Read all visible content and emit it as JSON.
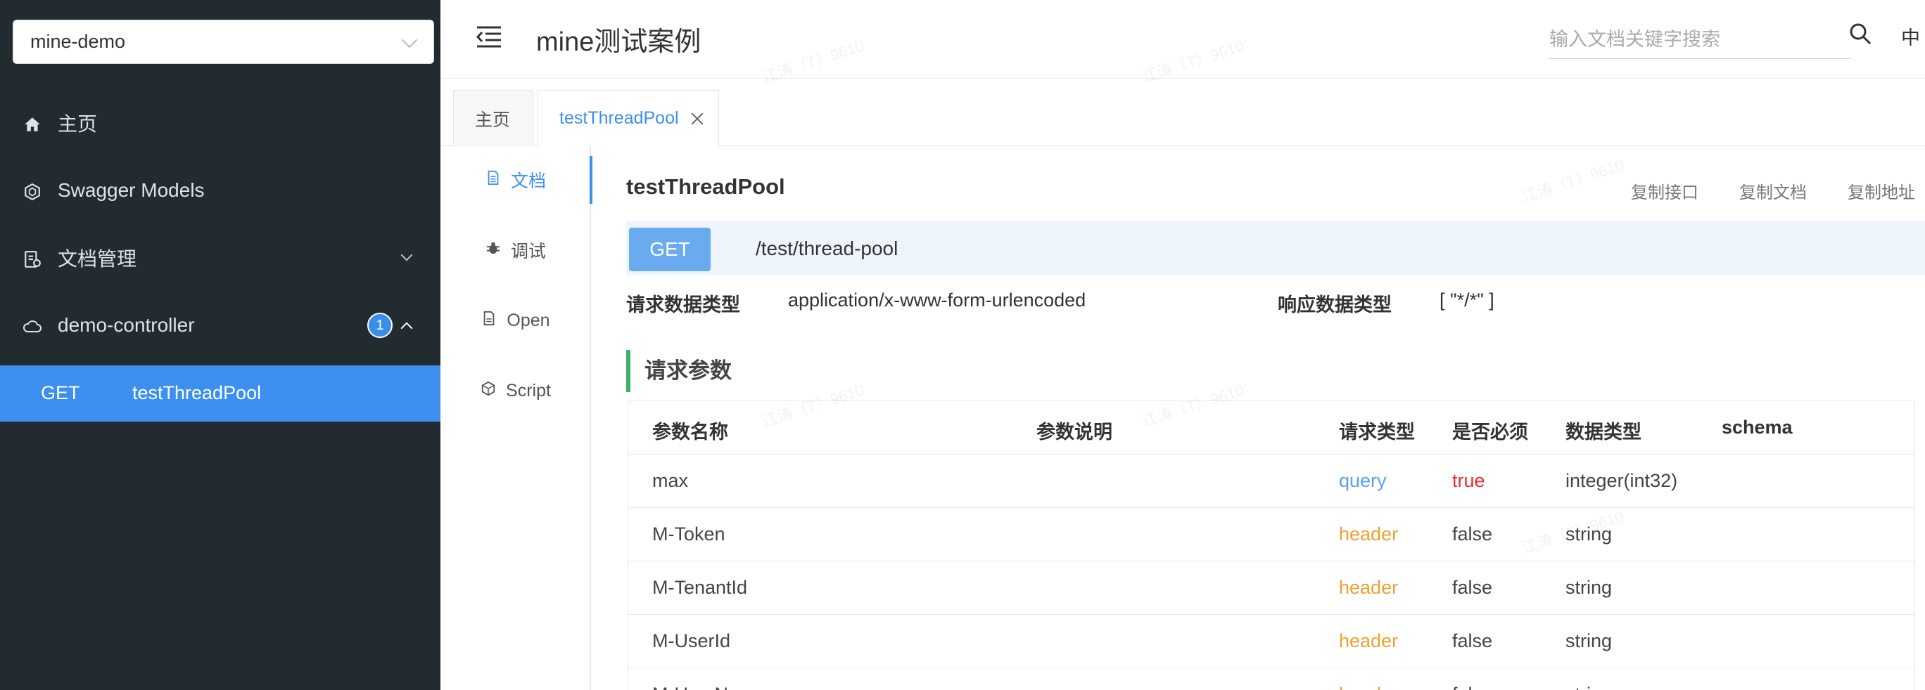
{
  "sidebar": {
    "project_select": "mine-demo",
    "items": [
      {
        "label": "主页",
        "icon": "home-icon"
      },
      {
        "label": "Swagger Models",
        "icon": "models-icon"
      },
      {
        "label": "文档管理",
        "icon": "doc-manage-icon"
      },
      {
        "label": "demo-controller",
        "icon": "cloud-icon",
        "badge": "1"
      }
    ],
    "active_api": {
      "method": "GET",
      "name": "testThreadPool"
    }
  },
  "header": {
    "title": "mine测试案例",
    "search_placeholder": "输入文档关键字搜索",
    "lang": "中"
  },
  "tabs": [
    {
      "label": "主页"
    },
    {
      "label": "testThreadPool"
    }
  ],
  "side_tabs": [
    {
      "label": "文档",
      "icon": "document-icon"
    },
    {
      "label": "调试",
      "icon": "bug-icon"
    },
    {
      "label": "Open",
      "icon": "file-icon"
    },
    {
      "label": "Script",
      "icon": "code-icon"
    }
  ],
  "api": {
    "name": "testThreadPool",
    "actions": [
      "复制接口",
      "复制文档",
      "复制地址"
    ],
    "method": "GET",
    "path": "/test/thread-pool",
    "request_type_label": "请求数据类型",
    "request_type": "application/x-www-form-urlencoded",
    "response_type_label": "响应数据类型",
    "response_type": "[ \"*/*\" ]"
  },
  "params": {
    "section_title": "请求参数",
    "columns": [
      "参数名称",
      "参数说明",
      "请求类型",
      "是否必须",
      "数据类型",
      "schema"
    ],
    "rows": [
      {
        "name": "max",
        "desc": "",
        "in": "query",
        "required": "true",
        "type": "integer(int32)",
        "schema": ""
      },
      {
        "name": "M-Token",
        "desc": "",
        "in": "header",
        "required": "false",
        "type": "string",
        "schema": ""
      },
      {
        "name": "M-TenantId",
        "desc": "",
        "in": "header",
        "required": "false",
        "type": "string",
        "schema": ""
      },
      {
        "name": "M-UserId",
        "desc": "",
        "in": "header",
        "required": "false",
        "type": "string",
        "schema": ""
      },
      {
        "name": "M-UserN",
        "desc": "",
        "in": "header",
        "required": "false",
        "type": "string",
        "schema": ""
      }
    ]
  },
  "watermark": "江涛（T）9610"
}
